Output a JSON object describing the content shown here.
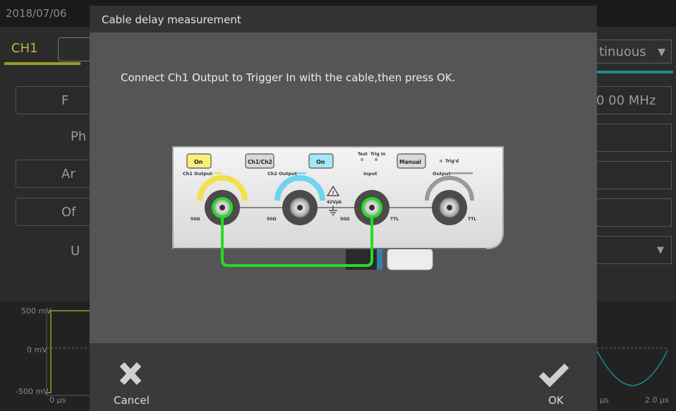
{
  "background_app": {
    "date": "2018/07/06",
    "channel_tab": "CH1",
    "mode_select": "tinuous",
    "param_buttons": [
      "F",
      "Ph",
      "Ar",
      "Of",
      "U"
    ],
    "frequency_value": "0 00 MHz",
    "waveform": {
      "y_labels": [
        "500 mV",
        "0 mV",
        "-500 mV"
      ],
      "x_labels": [
        "0 µs",
        "µs",
        "2.0 µs"
      ]
    }
  },
  "dialog": {
    "title": "Cable delay measurement",
    "message": "Connect Ch1 Output to Trigger In with the cable,then press OK.",
    "cancel_label": "Cancel",
    "ok_label": "OK"
  },
  "panel": {
    "buttons": {
      "ch1_on": "On",
      "ch1_ch2": "Ch1/Ch2",
      "ch2_on": "On",
      "manual": "Manual"
    },
    "labels": {
      "ch1_output": "Ch1 Output",
      "ch2_output": "Ch2 Output",
      "test": "Test",
      "trig_in": "Trig In",
      "input": "Input",
      "trigd": "Trig'd",
      "output": "Output",
      "ohm1": "50Ω",
      "ohm2": "50Ω",
      "ohm3": "50Ω",
      "ttl1": "TTL",
      "ttl2": "TTL",
      "vpk": "42Vpk"
    },
    "colors": {
      "ch1": "#f2e04b",
      "ch2": "#6fd4ee",
      "cable": "#22dd22"
    }
  }
}
